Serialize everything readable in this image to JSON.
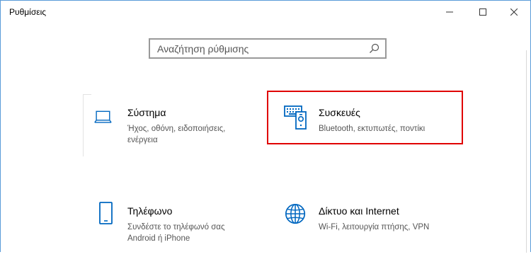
{
  "window": {
    "title": "Ρυθμίσεις",
    "controls": {
      "minimize": "minimize-icon",
      "maximize": "maximize-icon",
      "close": "close-icon"
    }
  },
  "search": {
    "placeholder": "Αναζήτηση ρύθμισης",
    "value": "",
    "icon": "search-icon"
  },
  "categories": [
    {
      "title": "Σύστημα",
      "description": "Ήχος, οθόνη, ειδοποιήσεις, ενέργεια",
      "icon": "laptop-icon",
      "highlighted": false
    },
    {
      "title": "Συσκευές",
      "description": "Bluetooth, εκτυπωτές, ποντίκι",
      "icon": "devices-icon",
      "highlighted": true
    },
    {
      "title": "Τηλέφωνο",
      "description": "Συνδέστε το τηλέφωνό σας Android ή iPhone",
      "icon": "phone-icon",
      "highlighted": false
    },
    {
      "title": "Δίκτυο και Internet",
      "description": "Wi-Fi, λειτουργία πτήσης, VPN",
      "icon": "globe-icon",
      "highlighted": false
    }
  ],
  "colors": {
    "accent": "#0067c0",
    "highlight": "#e00000",
    "window_border": "#5a9bd8"
  }
}
